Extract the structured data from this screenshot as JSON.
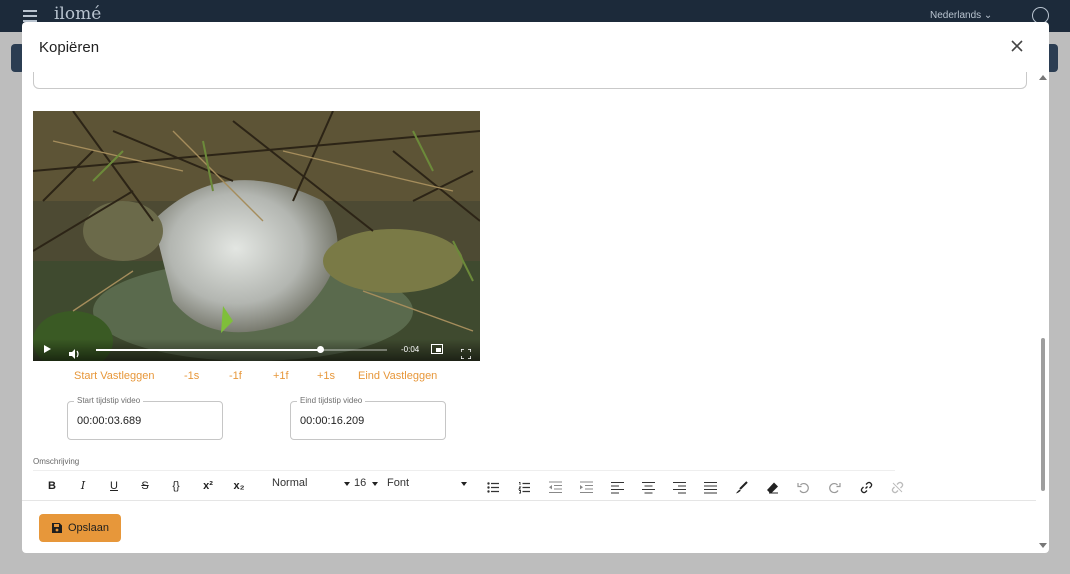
{
  "app": {
    "logo_text": "ilomé",
    "language": "Nederlands"
  },
  "modal": {
    "title": "Kopiëren"
  },
  "video": {
    "time_remaining": "-0:04",
    "progress": 0.77
  },
  "capture_buttons": [
    "Start Vastleggen",
    "-1s",
    "-1f",
    "+1f",
    "+1s",
    "Eind Vastleggen"
  ],
  "start_field": {
    "label": "Start tijdstip video",
    "value": "00:00:03.689"
  },
  "end_field": {
    "label": "Eind tijdstip video",
    "value": "00:00:16.209"
  },
  "description": {
    "label": "Omschrijving"
  },
  "toolbar": {
    "bold": "B",
    "italic": "I",
    "underline": "U",
    "strike": "S",
    "code": "{}",
    "superscript": "x²",
    "subscript": "x₂",
    "heading_select": "Normal",
    "size_select": "16",
    "font_select": "Font",
    "icons": [
      "bullet-list-icon",
      "numbered-list-icon",
      "outdent-icon",
      "indent-icon",
      "align-left-icon",
      "align-center-icon",
      "align-right-icon",
      "align-justify-icon",
      "brush-icon",
      "eraser-icon",
      "undo-icon",
      "redo-icon",
      "link-icon",
      "unlink-icon"
    ]
  },
  "footer": {
    "save_label": "Opslaan"
  },
  "colors": {
    "accent": "#e7973a",
    "topbar": "#1c2a3a"
  }
}
